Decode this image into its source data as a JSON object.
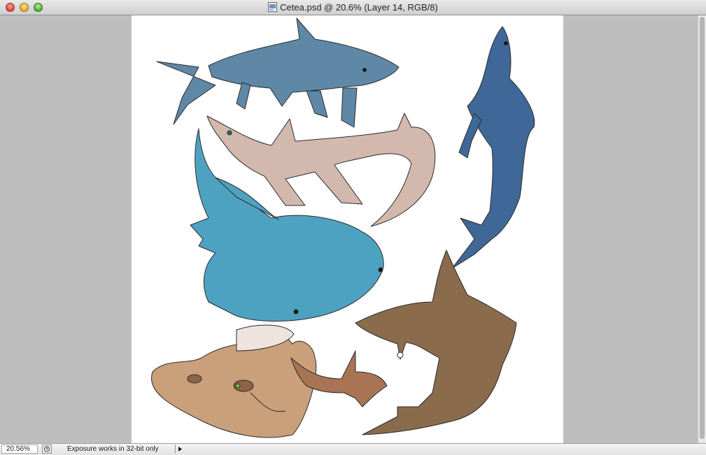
{
  "window": {
    "title": "Cetea.psd @ 20.6% (Layer 14, RGB/8)"
  },
  "status": {
    "zoom": "20.56%",
    "info_text": "Exposure works in 32-bit only"
  },
  "canvas": {
    "background": "#ffffff",
    "creatures": [
      {
        "name": "grey-blue shark with legs",
        "color": "#5e88a6"
      },
      {
        "name": "pink long-tailed shark",
        "color": "#d3b8ae"
      },
      {
        "name": "dark blue upright shark",
        "color": "#3f6797"
      },
      {
        "name": "cyan whale shark",
        "color": "#4ea2c1"
      },
      {
        "name": "spotted brown wobbegong",
        "color": "#c9a07a"
      },
      {
        "name": "small brown shark",
        "color": "#a87454"
      },
      {
        "name": "brown hammerhead",
        "color": "#8a6b4c"
      }
    ]
  }
}
